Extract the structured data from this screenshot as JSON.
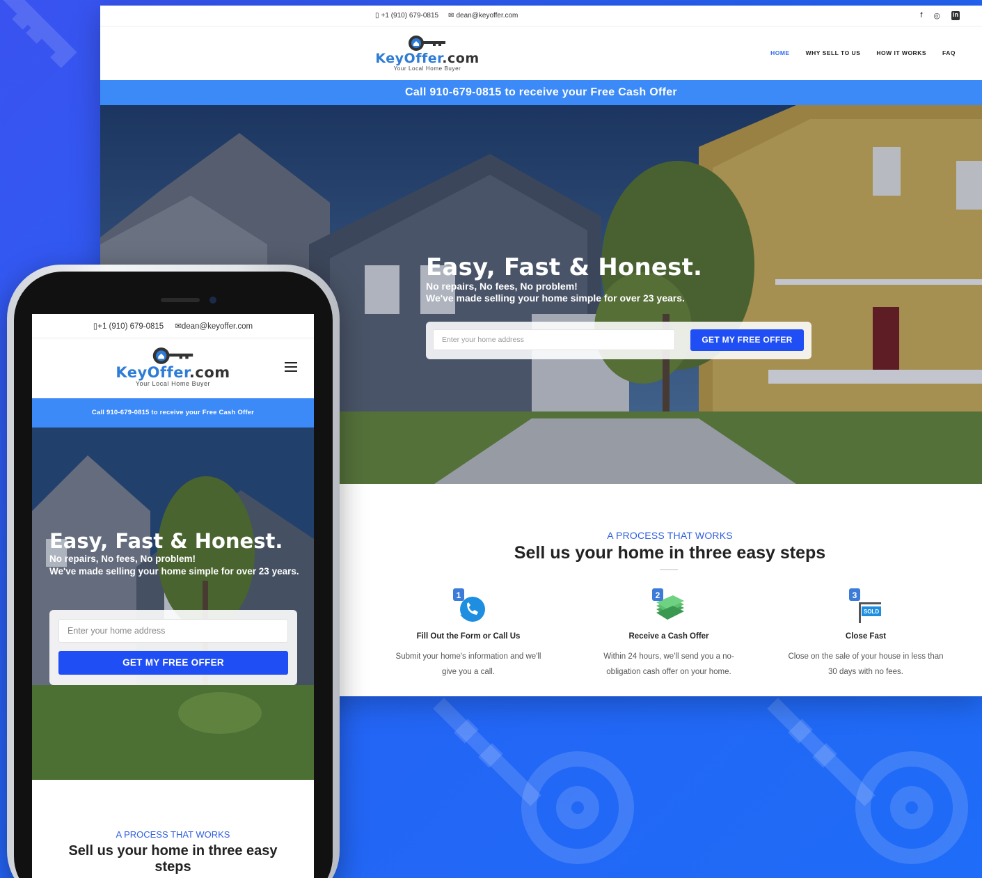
{
  "colors": {
    "accent": "#3c8af7",
    "button": "#1f4ef5",
    "brand_blue": "#2e7cd6",
    "eyebrow": "#2f5fe0",
    "background": "#2563f5"
  },
  "desktop": {
    "topbar": {
      "phone_icon": "phone-icon",
      "phone": "+1 (910) 679-0815",
      "email_icon": "envelope-icon",
      "email": "dean@keyoffer.com",
      "social": [
        "facebook-icon",
        "instagram-icon",
        "linkedin-icon"
      ],
      "social_glyphs": [
        "f",
        "◎",
        "in"
      ]
    },
    "logo": {
      "brand_main": "KeyOffer",
      "brand_tld": ".com",
      "tagline": "Your Local Home Buyer"
    },
    "nav": [
      "HOME",
      "WHY SELL TO US",
      "HOW IT WORKS",
      "FAQ"
    ],
    "call_bar": "Call 910-679-0815 to receive your Free Cash Offer",
    "hero": {
      "title": "Easy, Fast & Honest.",
      "subtitle_line1": "No repairs, No fees, No problem!",
      "subtitle_line2": "We've made selling your home simple for over 23 years.",
      "input_placeholder": "Enter your home address",
      "cta": "GET MY FREE OFFER"
    },
    "process": {
      "eyebrow": "A PROCESS THAT WORKS",
      "heading": "Sell us your home in three easy steps",
      "steps": [
        {
          "number": "1",
          "icon": "phone-call-icon",
          "title": "Fill Out the Form or Call Us",
          "desc_line1": "Submit your home's information and we'll",
          "desc_line2": "give you a call."
        },
        {
          "number": "2",
          "icon": "cash-stack-icon",
          "title": "Receive a Cash Offer",
          "desc_line1": "Within 24 hours, we'll send you a no-",
          "desc_line2": "obligation cash offer on your home."
        },
        {
          "number": "3",
          "icon": "sold-sign-icon",
          "sign_text": "SOLD",
          "title": "Close Fast",
          "desc_line1": "Close on the sale of your house in less than",
          "desc_line2": "30 days with no fees."
        }
      ]
    }
  },
  "mobile": {
    "topbar": {
      "phone": "+1 (910) 679-0815",
      "email": "dean@keyoffer.com"
    },
    "logo": {
      "brand_main": "KeyOffer",
      "brand_tld": ".com",
      "tagline": "Your Local Home Buyer"
    },
    "call_bar": "Call 910-679-0815 to receive your Free Cash Offer",
    "hero": {
      "title": "Easy, Fast & Honest.",
      "subtitle_line1": "No repairs, No fees, No problem!",
      "subtitle_line2": "We've made selling your home simple for over 23 years.",
      "input_placeholder": "Enter your home address",
      "cta": "GET MY FREE OFFER"
    },
    "process": {
      "eyebrow": "A PROCESS THAT WORKS",
      "heading": "Sell us your home in three easy steps"
    }
  }
}
